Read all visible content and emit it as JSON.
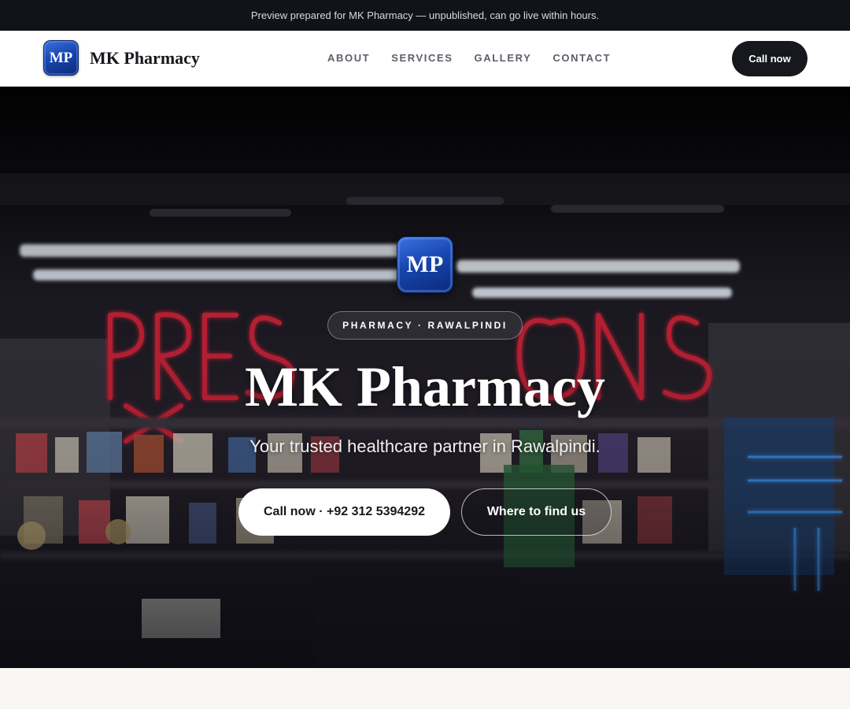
{
  "preview_banner": "Preview prepared for MK Pharmacy — unpublished, can go live within hours.",
  "brand": {
    "logo_text": "MP",
    "name": "MK Pharmacy"
  },
  "nav": {
    "links": [
      "ABOUT",
      "SERVICES",
      "GALLERY",
      "CONTACT"
    ],
    "cta": "Call now"
  },
  "hero": {
    "logo_text": "MP",
    "eyebrow": "PHARMACY · RAWALPINDI",
    "title": "MK Pharmacy",
    "subtitle": "Your trusted healthcare partner in Rawalpindi.",
    "primary_button": "Call now · +92 312 5394292",
    "secondary_button": "Where to find us",
    "background_image": "pharmacy-storefront-neon-prescriptions-photo"
  },
  "colors": {
    "dark": "#16181d",
    "logo_blue": "#1846b0",
    "neon_red": "#d0283c",
    "neon_blue": "#3a8cff"
  }
}
